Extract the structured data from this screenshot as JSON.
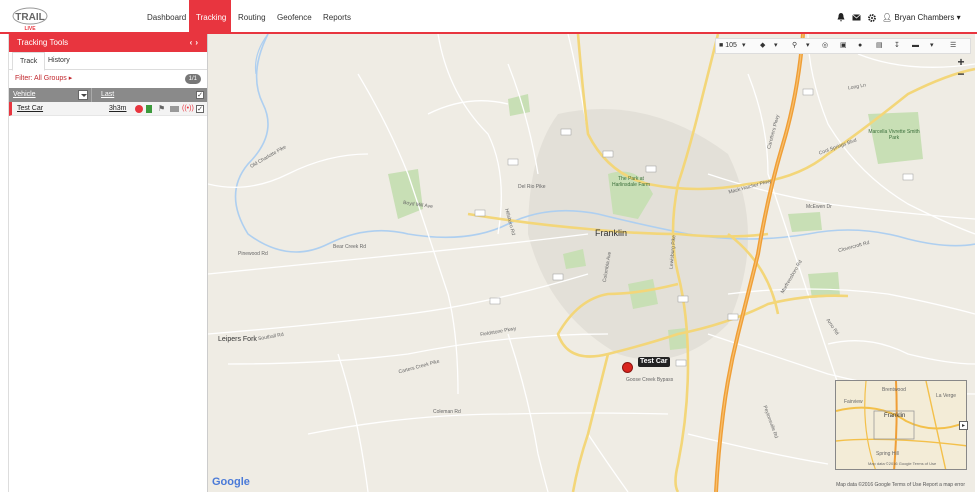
{
  "app": {
    "logo_text": "TRAIL",
    "logo_sub": "LIVE",
    "accent_color": "#e8353f"
  },
  "nav": {
    "items": [
      "Dashboard",
      "Tracking",
      "Routing",
      "Geofence",
      "Reports"
    ],
    "active": "Tracking",
    "user_name": "Bryan Chambers",
    "icons": [
      "bell-icon",
      "envelope-icon",
      "gear-icon",
      "user-icon"
    ]
  },
  "sidebar": {
    "title": "Tracking Tools",
    "tabs": [
      "Track",
      "History"
    ],
    "active_tab": "Track",
    "filter_label": "Filter: All Groups",
    "count": "1/1",
    "columns": {
      "vehicle": "Vehicle",
      "last": "Last"
    },
    "vehicles": [
      {
        "name": "Test Car",
        "last": "3h3m",
        "icons": [
          "stopped-icon",
          "battery-icon",
          "flag-icon",
          "message-icon",
          "signal-icon"
        ],
        "checked": true
      }
    ]
  },
  "map": {
    "toolbar": {
      "unit_count": "105"
    },
    "towns": {
      "franklin": "Franklin",
      "leipers_fork": "Leipers Fork"
    },
    "parks": {
      "park_harlinsdale": "The Park at Harlinsdale Farm",
      "marcella_vivrette": "Marcella Vivrette Smith Park"
    },
    "roads": [
      "Boyd Mill Ave",
      "Hillsboro Rd",
      "Mack Hatcher Pkwy",
      "Murfreesboro Rd",
      "Columbia Ave",
      "Lewisburg Pike",
      "Carothers Pkwy",
      "McEwen Dr",
      "Cool Springs Blvd",
      "Old Charlotte Pike",
      "Del Rio Pike",
      "Fieldstone Pkwy",
      "Peytonsville Rd",
      "Goose Creek Bypass",
      "Southall Rd",
      "Pinewood Rd",
      "Carters Creek Pike",
      "Coleman Rd",
      "Bear Creek Rd",
      "Clovercroft Rd",
      "Arno Rd",
      "Long Ln"
    ],
    "marker_label": "Test Car",
    "overview_labels": {
      "brentwood": "Brentwood",
      "franklin": "Franklin",
      "spring_hill": "Spring Hill",
      "fairview": "Fairview",
      "la_vergne": "La Verge"
    },
    "overview_credit": "Map data ©2016 Google  Terms of Use",
    "google_logo": "Google",
    "credit": "Map data ©2016 Google   Terms of Use   Report a map error"
  }
}
